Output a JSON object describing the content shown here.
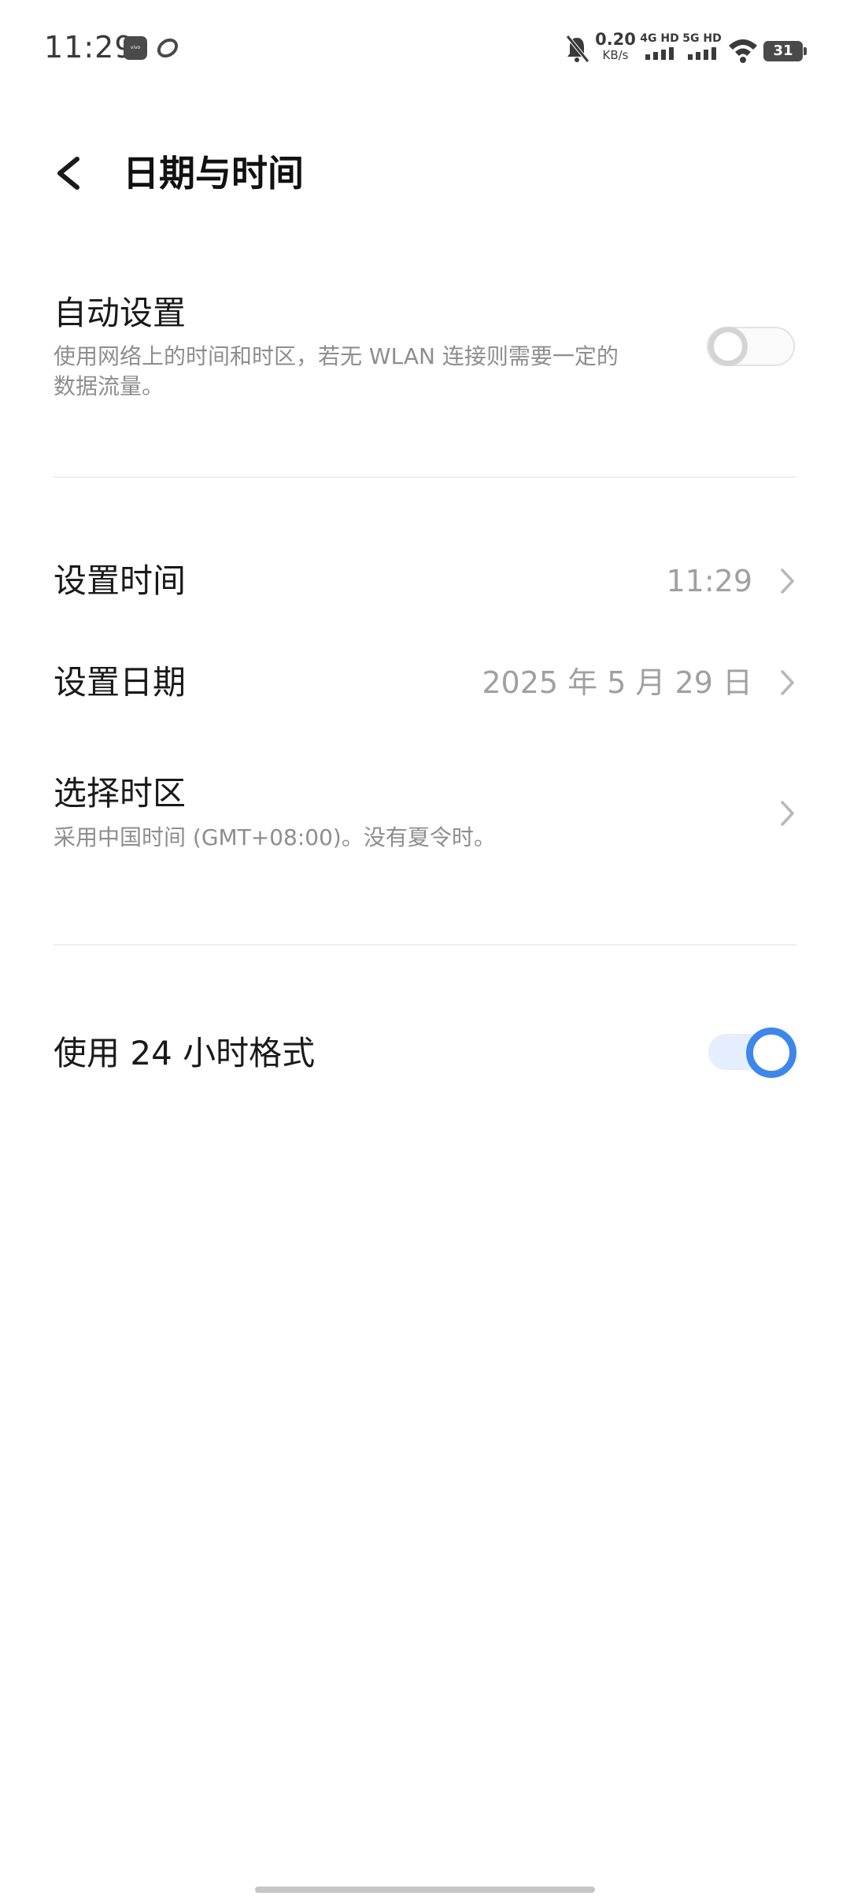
{
  "status_bar": {
    "time": "11:29",
    "app_icons": [
      "vivo-icon",
      "app-link-icon"
    ],
    "app_icon_text": "vivo",
    "net_speed_value": "0.20",
    "net_speed_unit": "KB/s",
    "signal1_label": "4G HD",
    "signal2_label": "5G HD",
    "battery": "31"
  },
  "header": {
    "title": "日期与时间"
  },
  "auto_settings": {
    "title": "自动设置",
    "description_line1": "使用网络上的时间和时区，若无 WLAN 连接则需要一定的",
    "description_line2": "数据流量。",
    "enabled": false
  },
  "set_time": {
    "title": "设置时间",
    "value": "11:29"
  },
  "set_date": {
    "title": "设置日期",
    "value": "2025 年 5 月 29 日"
  },
  "timezone": {
    "title": "选择时区",
    "description": "采用中国时间 (GMT+08:00)。没有夏令时。"
  },
  "format_24h": {
    "title": "使用 24 小时格式",
    "enabled": true
  },
  "colors": {
    "accent": "#3e87ea",
    "accent_track": "#e4eefc",
    "secondary_text": "#8e8e8e",
    "divider": "#efefef"
  }
}
